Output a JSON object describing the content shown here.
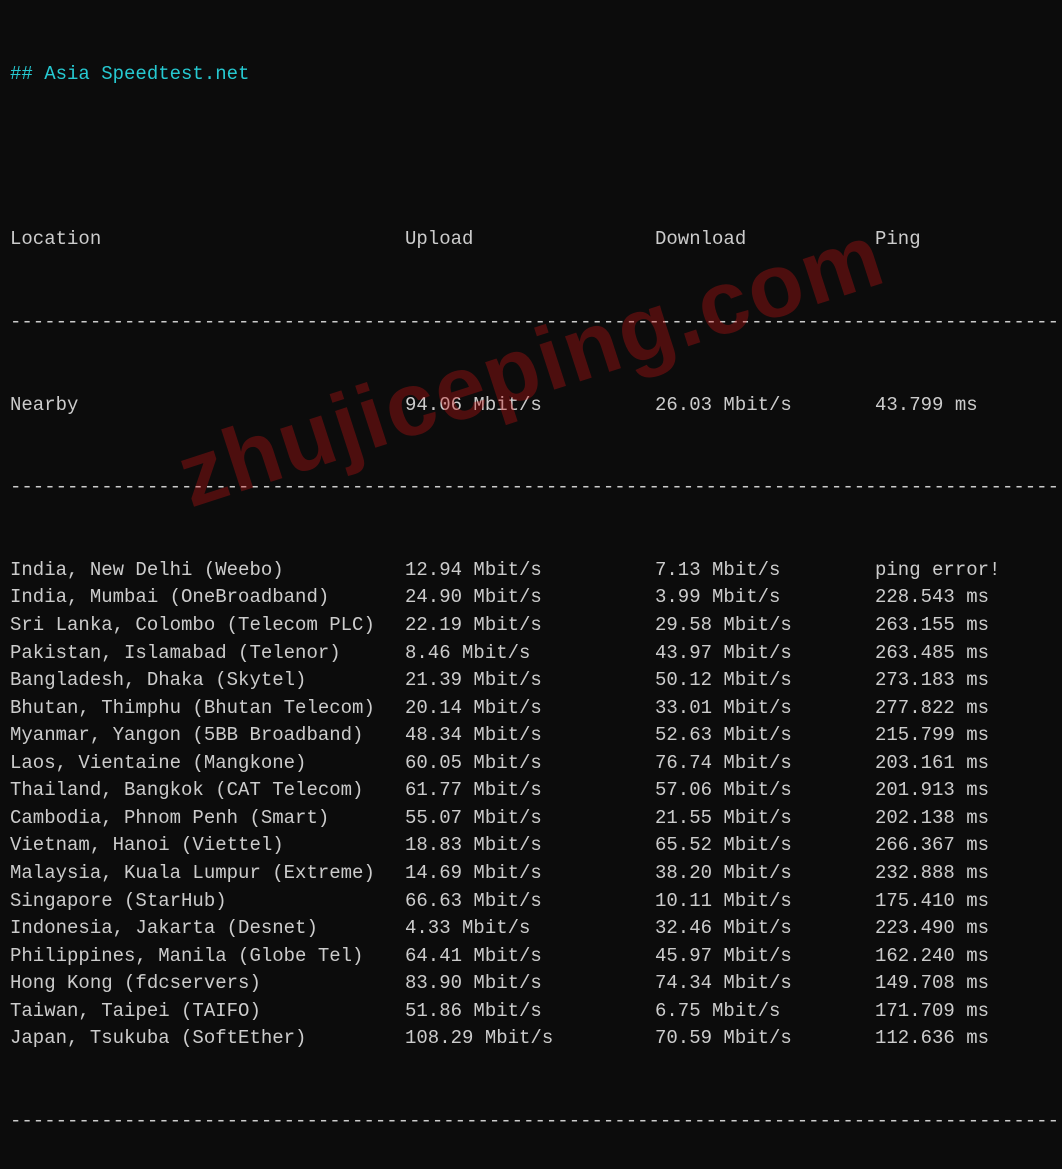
{
  "title": "## Asia Speedtest.net",
  "headers": {
    "location": "Location",
    "upload": "Upload",
    "download": "Download",
    "ping": "Ping"
  },
  "nearby": {
    "location": "Nearby",
    "upload": "94.06 Mbit/s",
    "download": "26.03 Mbit/s",
    "ping": "43.799 ms"
  },
  "rows": [
    {
      "location": "India, New Delhi (Weebo)",
      "upload": "12.94 Mbit/s",
      "download": "7.13 Mbit/s",
      "ping": "ping error!"
    },
    {
      "location": "India, Mumbai (OneBroadband)",
      "upload": "24.90 Mbit/s",
      "download": "3.99 Mbit/s",
      "ping": "228.543 ms"
    },
    {
      "location": "Sri Lanka, Colombo (Telecom PLC)",
      "upload": "22.19 Mbit/s",
      "download": "29.58 Mbit/s",
      "ping": "263.155 ms"
    },
    {
      "location": "Pakistan, Islamabad (Telenor)",
      "upload": "8.46 Mbit/s",
      "download": "43.97 Mbit/s",
      "ping": "263.485 ms"
    },
    {
      "location": "Bangladesh, Dhaka (Skytel)",
      "upload": "21.39 Mbit/s",
      "download": "50.12 Mbit/s",
      "ping": "273.183 ms"
    },
    {
      "location": "Bhutan, Thimphu (Bhutan Telecom)",
      "upload": "20.14 Mbit/s",
      "download": "33.01 Mbit/s",
      "ping": "277.822 ms"
    },
    {
      "location": "Myanmar, Yangon (5BB Broadband)",
      "upload": "48.34 Mbit/s",
      "download": "52.63 Mbit/s",
      "ping": "215.799 ms"
    },
    {
      "location": "Laos, Vientaine (Mangkone)",
      "upload": "60.05 Mbit/s",
      "download": "76.74 Mbit/s",
      "ping": "203.161 ms"
    },
    {
      "location": "Thailand, Bangkok (CAT Telecom)",
      "upload": "61.77 Mbit/s",
      "download": "57.06 Mbit/s",
      "ping": "201.913 ms"
    },
    {
      "location": "Cambodia, Phnom Penh (Smart)",
      "upload": "55.07 Mbit/s",
      "download": "21.55 Mbit/s",
      "ping": "202.138 ms"
    },
    {
      "location": "Vietnam, Hanoi (Viettel)",
      "upload": "18.83 Mbit/s",
      "download": "65.52 Mbit/s",
      "ping": "266.367 ms"
    },
    {
      "location": "Malaysia, Kuala Lumpur (Extreme)",
      "upload": "14.69 Mbit/s",
      "download": "38.20 Mbit/s",
      "ping": "232.888 ms"
    },
    {
      "location": "Singapore (StarHub)",
      "upload": "66.63 Mbit/s",
      "download": "10.11 Mbit/s",
      "ping": "175.410 ms"
    },
    {
      "location": "Indonesia, Jakarta (Desnet)",
      "upload": "4.33 Mbit/s",
      "download": "32.46 Mbit/s",
      "ping": "223.490 ms"
    },
    {
      "location": "Philippines, Manila (Globe Tel)",
      "upload": "64.41 Mbit/s",
      "download": "45.97 Mbit/s",
      "ping": "162.240 ms"
    },
    {
      "location": "Hong Kong (fdcservers)",
      "upload": "83.90 Mbit/s",
      "download": "74.34 Mbit/s",
      "ping": "149.708 ms"
    },
    {
      "location": "Taiwan, Taipei (TAIFO)",
      "upload": "51.86 Mbit/s",
      "download": "6.75 Mbit/s",
      "ping": "171.709 ms"
    },
    {
      "location": "Japan, Tsukuba (SoftEther)",
      "upload": "108.29 Mbit/s",
      "download": "70.59 Mbit/s",
      "ping": "112.636 ms"
    }
  ],
  "dashline": "----------------------------------------------------------------------------------------------",
  "watermark": "zhujiceping.com"
}
